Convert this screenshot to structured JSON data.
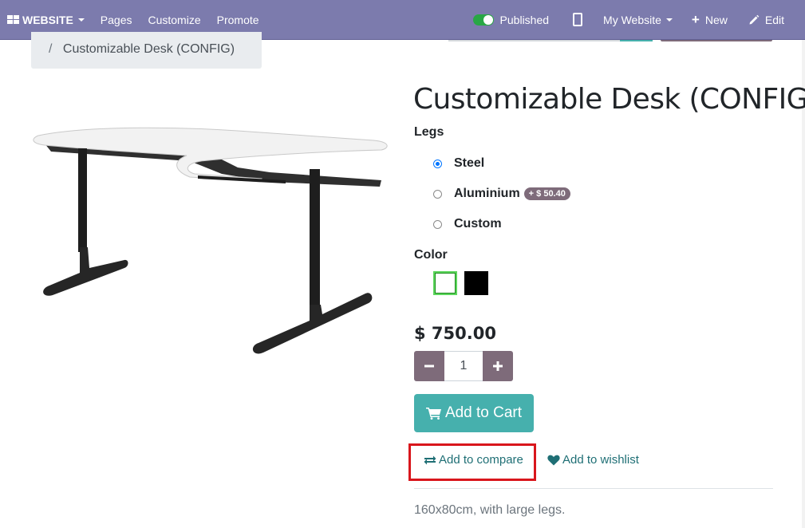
{
  "topbar": {
    "website_label": "WEBSITE",
    "pages_label": "Pages",
    "customize_label": "Customize",
    "promote_label": "Promote",
    "published_label": "Published",
    "my_website_label": "My Website",
    "new_label": "New",
    "edit_label": "Edit",
    "bg_color": "#7c7bad"
  },
  "breadcrumb": {
    "separator": "/",
    "current": "Customizable Desk (CONFIG)"
  },
  "product": {
    "title": "Customizable Desk (CONFIG)",
    "image_icon": "desk-image",
    "legs": {
      "label": "Legs",
      "options": [
        {
          "label": "Steel",
          "selected": true
        },
        {
          "label": "Aluminium",
          "extra": "+ $ 50.40",
          "selected": false
        },
        {
          "label": "Custom",
          "selected": false
        }
      ]
    },
    "color": {
      "label": "Color",
      "swatches": [
        {
          "name": "white",
          "color": "#ffffff",
          "selected": true
        },
        {
          "name": "black",
          "color": "#000000",
          "selected": false
        }
      ]
    },
    "price": "$ 750.00",
    "quantity": "1",
    "add_to_cart_label": "Add to Cart",
    "add_to_compare_label": "Add to compare",
    "add_to_wishlist_label": "Add to wishlist",
    "description": "160x80cm, with large legs.",
    "accent_color": "#46b0ad",
    "secondary_color": "#7e6b7a"
  }
}
